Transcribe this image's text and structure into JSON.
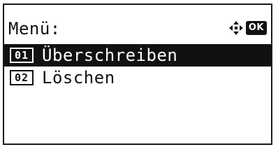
{
  "header": {
    "title": "Menü:",
    "nav_icon": "four-way-arrow-icon",
    "ok_label": "OK"
  },
  "menu": {
    "items": [
      {
        "number": "01",
        "label": "Überschreiben",
        "selected": true
      },
      {
        "number": "02",
        "label": "Löschen",
        "selected": false
      }
    ]
  },
  "colors": {
    "foreground": "#111111",
    "background": "#ffffff",
    "highlight": "#111111"
  }
}
